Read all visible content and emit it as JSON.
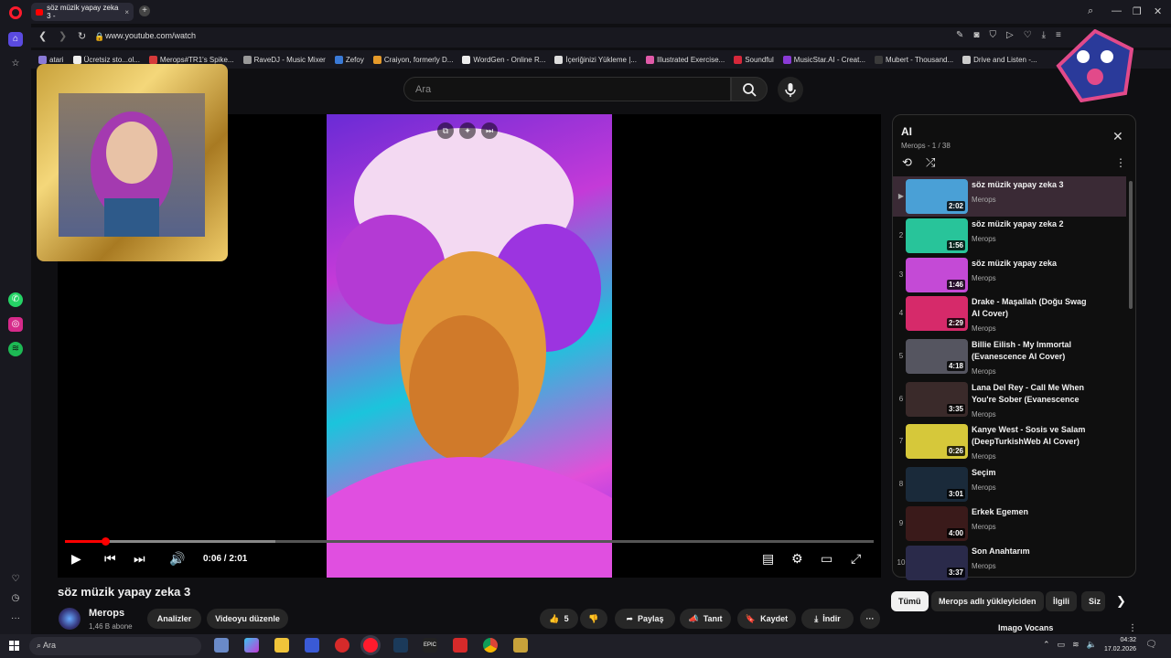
{
  "browser": {
    "tab_title": "söz müzik yapay zeka 3 -",
    "url": "www.youtube.com/watch",
    "bookmarks": [
      {
        "label": "atari",
        "color": "#8a7ad6"
      },
      {
        "label": "Ücretsiz sto...ol...",
        "color": "#eeeeee"
      },
      {
        "label": "Merops#TR1's Spike...",
        "color": "#d63a3a"
      },
      {
        "label": "RaveDJ - Music Mixer",
        "color": "#999999"
      },
      {
        "label": "Zefoy",
        "color": "#3a7ad6"
      },
      {
        "label": "Craiyon, formerly D...",
        "color": "#e59a2a"
      },
      {
        "label": "WordGen - Online R...",
        "color": "#eeeeee"
      },
      {
        "label": "İçeriğinizi Yükleme |...",
        "color": "#dddddd"
      },
      {
        "label": "Illustrated Exercise...",
        "color": "#e05aa8"
      },
      {
        "label": "Soundful",
        "color": "#d6283a"
      },
      {
        "label": "MusicStar.AI - Creat...",
        "color": "#8a3ad6"
      },
      {
        "label": "Mubert - Thousand...",
        "color": "#3a3a3a"
      },
      {
        "label": "Drive and Listen -...",
        "color": "#cccccc"
      }
    ]
  },
  "youtube": {
    "search_placeholder": "Ara",
    "video": {
      "title": "söz müzik yapay zeka 3",
      "timecode": "0:06 / 2:01",
      "progress": 0.05,
      "buffered": 0.26,
      "channel": "Merops",
      "subscribers": "1,46 B abone",
      "likes": "5"
    },
    "actions": {
      "analytics": "Analizler",
      "edit": "Videoyu düzenle",
      "share": "Paylaş",
      "promote": "Tanıt",
      "save": "Kaydet",
      "download": "İndir"
    },
    "playlist": {
      "title": "AI",
      "owner": "Merops",
      "position": "1 / 38",
      "items": [
        {
          "num": "▶",
          "title": "söz müzik yapay zeka 3",
          "channel": "Merops",
          "duration": "2:02",
          "thumb": "#4aa0d6"
        },
        {
          "num": "2",
          "title": "söz müzik yapay zeka 2",
          "channel": "Merops",
          "duration": "1:56",
          "thumb": "#28c49a"
        },
        {
          "num": "3",
          "title": "söz müzik yapay zeka",
          "channel": "Merops",
          "duration": "1:46",
          "thumb": "#c44ad6"
        },
        {
          "num": "4",
          "title": "Drake - Maşallah (Doğu Swag AI Cover)",
          "channel": "Merops",
          "duration": "2:29",
          "thumb": "#d62a6a"
        },
        {
          "num": "5",
          "title": "Billie Eilish - My Immortal (Evanescence AI Cover)",
          "channel": "Merops",
          "duration": "4:18",
          "thumb": "#555560"
        },
        {
          "num": "6",
          "title": "Lana Del Rey - Call Me When You're Sober (Evanescence AI...",
          "channel": "Merops",
          "duration": "3:35",
          "thumb": "#3a2a2a"
        },
        {
          "num": "7",
          "title": "Kanye West - Sosis ve Salam (DeepTurkishWeb AI Cover)",
          "channel": "Merops",
          "duration": "0:26",
          "thumb": "#d6c83a"
        },
        {
          "num": "8",
          "title": "Seçim",
          "channel": "Merops",
          "duration": "3:01",
          "thumb": "#1a2a3a"
        },
        {
          "num": "9",
          "title": "Erkek Egemen",
          "channel": "Merops",
          "duration": "4:00",
          "thumb": "#3a1a1a"
        },
        {
          "num": "10",
          "title": "Son Anahtarım",
          "channel": "Merops",
          "duration": "3:37",
          "thumb": "#2a2a4a"
        }
      ]
    },
    "chips": [
      "Tümü",
      "Merops adlı yükleyiciden",
      "İlgili",
      "Siz"
    ],
    "recommendation_title": "Imago Vocans"
  },
  "taskbar": {
    "search": "Ara",
    "time": "04:32",
    "date": "17.02.2026"
  }
}
